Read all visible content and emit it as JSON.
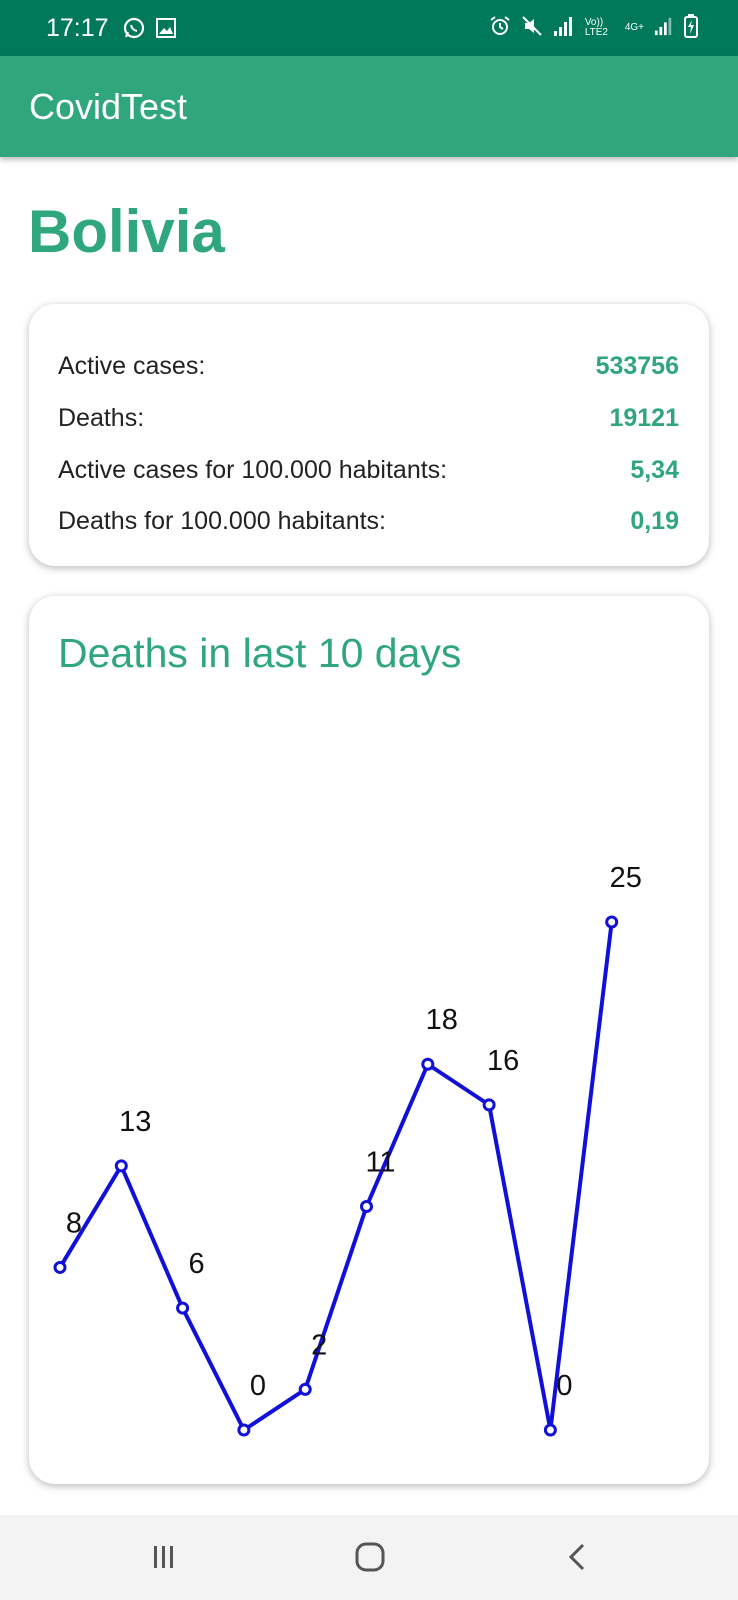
{
  "status_bar": {
    "time": "17:17",
    "left_icons": [
      "whatsapp-icon",
      "gallery-icon"
    ],
    "right_icons": [
      "alarm-icon",
      "mute-icon",
      "signal-icon",
      "volte-icon",
      "4g-icon",
      "signal-icon",
      "battery-charging-icon"
    ],
    "volte_label": "Vo)) LTE2",
    "network_label": "4G+"
  },
  "app_bar": {
    "title": "CovidTest"
  },
  "country": "Bolivia",
  "stats": [
    {
      "label": "Active cases:",
      "value": "533756"
    },
    {
      "label": "Deaths:",
      "value": "19121"
    },
    {
      "label": "Active cases for 100.000 habitants:",
      "value": "5,34"
    },
    {
      "label": "Deaths for 100.000 habitants:",
      "value": "0,19"
    }
  ],
  "chart_card": {
    "title": "Deaths in last 10 days"
  },
  "chart_data": {
    "type": "line",
    "title": "Deaths in last 10 days",
    "values": [
      8,
      13,
      6,
      0,
      2,
      11,
      18,
      16,
      0,
      25
    ],
    "ylim": [
      0,
      25
    ],
    "grid": false,
    "line_color": "#1010d8",
    "data_labels": true
  },
  "nav_bar": {
    "buttons": [
      "recents-icon",
      "home-icon",
      "back-icon"
    ]
  },
  "colors": {
    "status_bar": "#00795a",
    "accent": "#30a67c",
    "line": "#1010d8"
  }
}
